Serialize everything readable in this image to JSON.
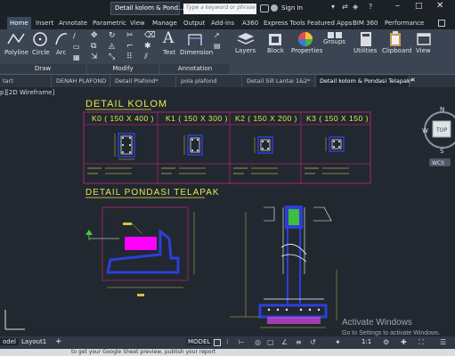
{
  "titlebar": {
    "doc_title": "Detail kolom & Pond...",
    "search_placeholder": "Type a keyword or phrase",
    "sign_in": "Sign In"
  },
  "ribbon_tabs": [
    "Home",
    "Insert",
    "Annotate",
    "Parametric",
    "View",
    "Manage",
    "Output",
    "Add-ins",
    "A360",
    "Express Tools",
    "Featured Apps",
    "BIM 360",
    "Performance"
  ],
  "ribbon": {
    "draw_tools": [
      "Polyline",
      "Circle",
      "Arc"
    ],
    "annotation_tools": [
      "Text",
      "Dimension"
    ],
    "large_tools": [
      "Layers",
      "Block",
      "Properties",
      "Groups",
      "Utilities",
      "Clipboard",
      "View"
    ],
    "panels": [
      "Draw",
      "Modify",
      "Annotation"
    ]
  },
  "doc_tabs": [
    "tart",
    "DENAH PLAFOND",
    "Detail Plafond*",
    "pola plafond",
    "Detail Sill Lantai 1&2*",
    "Detail kolom & Pondasi Telapak*"
  ],
  "viewport": {
    "label": "p][2D Wireframe]",
    "viewcube_top": "TOP",
    "compass": {
      "n": "N",
      "s": "S",
      "w": "W"
    },
    "wcs": "WCS"
  },
  "drawing": {
    "title_kolom": "DETAIL KOLOM",
    "title_pondasi": "DETAIL PONDASI TELAPAK",
    "columns": [
      {
        "label": "K0 ( 150 X 400 )"
      },
      {
        "label": "K1 ( 150 X 300 )"
      },
      {
        "label": "K2 ( 150 X 200 )"
      },
      {
        "label": "K3 ( 150 X 150 )"
      }
    ]
  },
  "watermark": {
    "title": "Activate Windows",
    "subtitle": "Go to Settings to activate Windows."
  },
  "statusbar": {
    "model_tab": "odel",
    "layout_tab": "Layout1",
    "add": "+",
    "model_button": "MODEL",
    "scale": "1:1"
  },
  "cmdline": {
    "text": "to get your Google Sheet preview, publish your report"
  },
  "colors": {
    "bg": "#212830",
    "frame": "#b0246a",
    "title": "#e7e84a",
    "concrete": "#2c3fd8",
    "rebar": "#ffffff",
    "dim": "#d6c240",
    "magenta": "#ff00ff"
  }
}
